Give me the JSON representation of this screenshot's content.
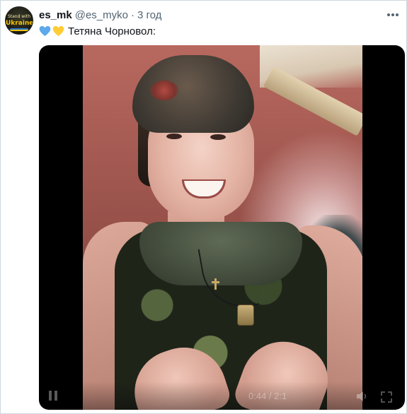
{
  "tweet": {
    "display_name": "es_mk",
    "handle": "@es_myko",
    "separator": "·",
    "time": "3 год",
    "text": "Тетяна Чорновол:",
    "emojis": [
      "blue-heart-icon",
      "yellow-heart-icon"
    ]
  },
  "avatar": {
    "top_text": "Stand with",
    "main_text": "Ukraine"
  },
  "video": {
    "timecode": "0:44 / 2:1"
  },
  "colors": {
    "blue_heart": "#5da9e9",
    "yellow_heart": "#ffcc33",
    "handle": "#536471"
  }
}
